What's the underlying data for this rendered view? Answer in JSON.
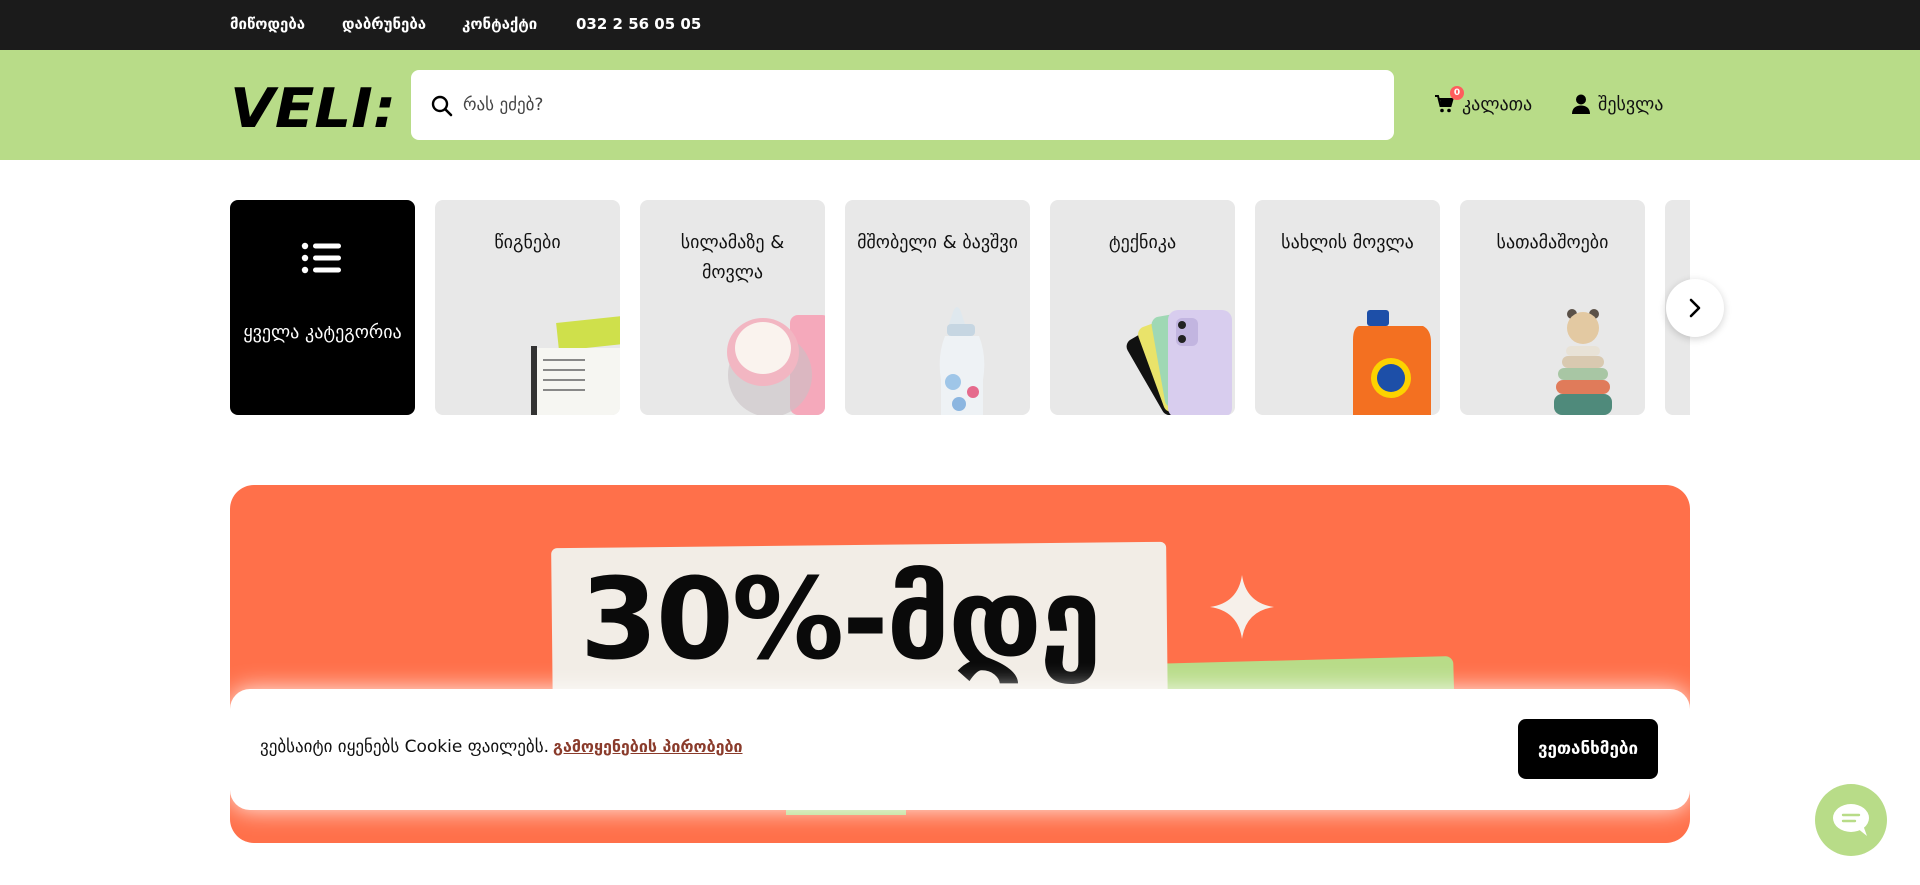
{
  "topbar": {
    "links": [
      "მიწოდება",
      "დაბრუნება",
      "კონტაქტი",
      "032 2 56 05 05"
    ]
  },
  "header": {
    "logo": "VELI:",
    "search_placeholder": "რას ეძებ?",
    "cart_label": "კალათა",
    "cart_count": "0",
    "login_label": "შესვლა"
  },
  "categories": {
    "all_label": "ყველა კატეგორია",
    "items": [
      {
        "label": "წიგნები",
        "icon": "books-image"
      },
      {
        "label": "სილამაზე & მოვლა",
        "icon": "cosmetics-image"
      },
      {
        "label": "მშობელი & ბავშვი",
        "icon": "baby-bottle-image"
      },
      {
        "label": "ტექნიკა",
        "icon": "phone-image"
      },
      {
        "label": "სახლის მოვლა",
        "icon": "detergent-image"
      },
      {
        "label": "სათამაშოები",
        "icon": "toy-image"
      }
    ]
  },
  "banner": {
    "promo_text": "30%-მდე"
  },
  "cookie": {
    "text": "ვებსაიტი იყენებს Cookie ფაილებს.",
    "link": "გამოყენების პირობები",
    "agree": "ვეთანხმები"
  },
  "colors": {
    "brand_green": "#b8dc88",
    "banner_orange": "#ff704a",
    "topbar": "#1b1b1b",
    "badge": "#ff5d5d"
  }
}
